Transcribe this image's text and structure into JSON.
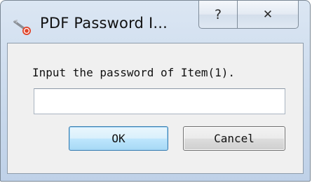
{
  "window": {
    "title": "PDF Password I...",
    "icon": "pdf-key-icon",
    "help_glyph": "?",
    "close_glyph": "✕"
  },
  "dialog": {
    "prompt": "Input the password of Item(1).",
    "password_value": "",
    "ok_label": "OK",
    "cancel_label": "Cancel"
  },
  "colors": {
    "frame": "#c9d9ec",
    "client_background": "#f0f0f0",
    "ok_border": "#3c7fb1",
    "ok_fill": "#bee6fd",
    "cancel_fill": "#dddddd"
  }
}
